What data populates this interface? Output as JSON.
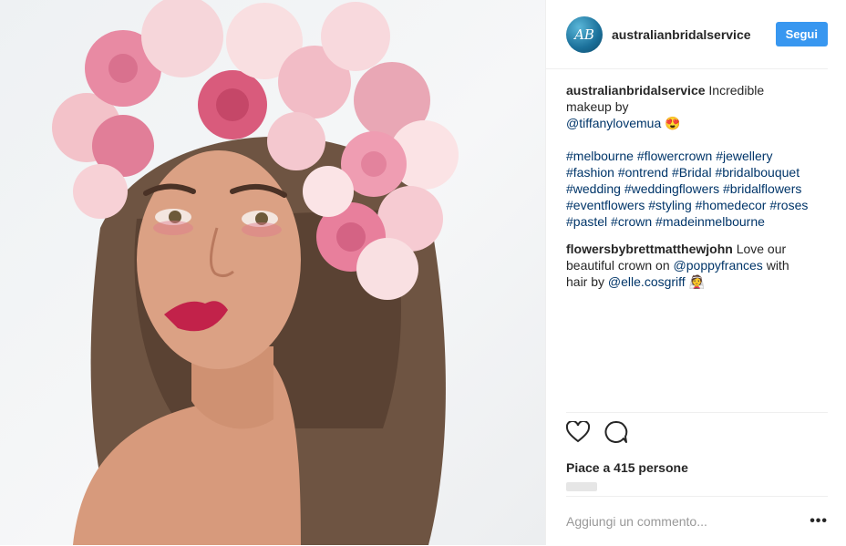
{
  "header": {
    "avatar_text": "AB",
    "username": "australianbridalservice",
    "follow_label": "Segui"
  },
  "comments": [
    {
      "user": "australianbridalservice",
      "text": "Incredible makeup by",
      "mention": "@tiffanylovemua",
      "emoji": "😍",
      "hashtags": "#melbourne #flowercrown #jewellery #fashion #ontrend #Bridal #bridalbouquet #wedding #weddingflowers #bridalflowers #eventflowers #styling #homedecor #roses #pastel #crown #madeinmelbourne"
    },
    {
      "user": "flowersbybrettmatthewjohn",
      "text1": "Love our beautiful crown on",
      "mention1": "@poppyfrances",
      "text2": "with hair by",
      "mention2": "@elle.cosgriff",
      "emoji": "👰"
    }
  ],
  "actions": {
    "like_icon": "heart-icon",
    "comment_icon": "comment-icon"
  },
  "likes": "Piace a 415 persone",
  "comment_input": {
    "placeholder": "Aggiungi un commento...",
    "more_label": "•••"
  },
  "colors": {
    "accent": "#3897f0",
    "link": "#003569",
    "text": "#262626",
    "muted": "#999999"
  }
}
